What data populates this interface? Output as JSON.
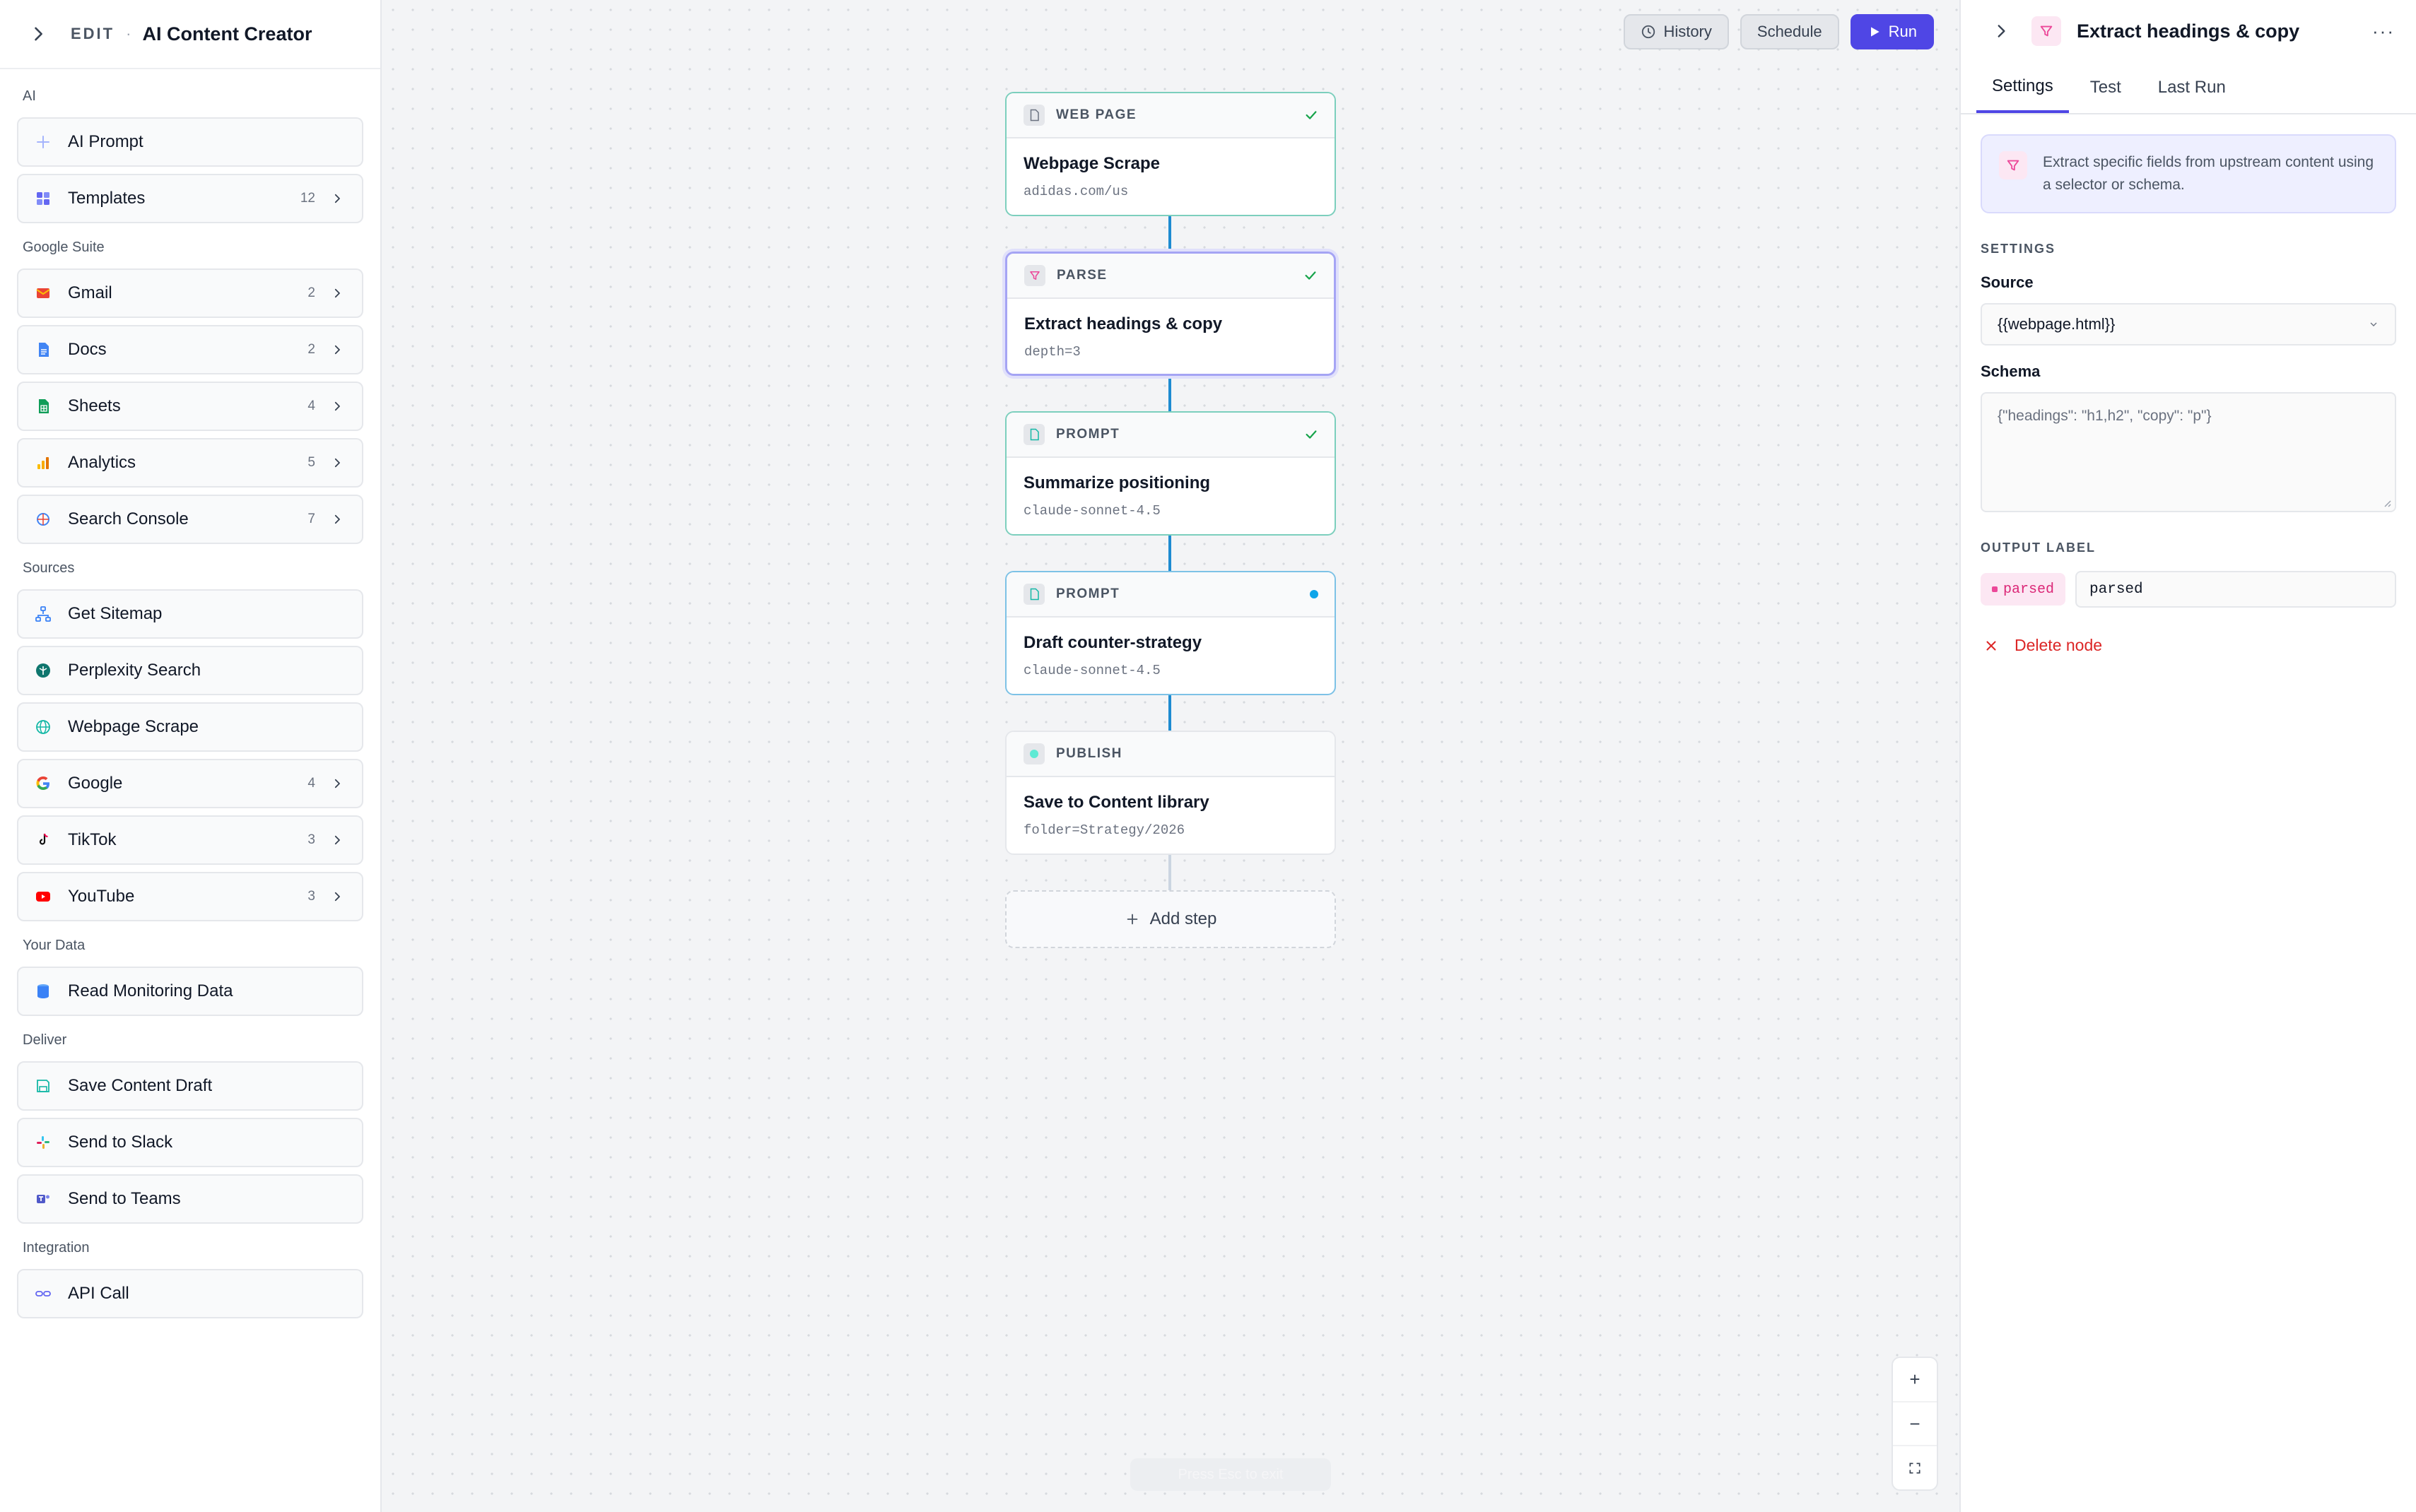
{
  "sidebar": {
    "edit_label": "EDIT",
    "separator": "·",
    "title": "AI Content Creator",
    "sections": [
      {
        "label": "AI",
        "items": [
          {
            "label": "AI Prompt",
            "icon": "sparkle-icon",
            "count": ""
          },
          {
            "label": "Templates",
            "icon": "grid-icon",
            "count": "12"
          }
        ]
      },
      {
        "label": "Google Suite",
        "items": [
          {
            "label": "Gmail",
            "icon": "gmail-icon",
            "count": "2"
          },
          {
            "label": "Docs",
            "icon": "docs-icon",
            "count": "2"
          },
          {
            "label": "Sheets",
            "icon": "sheets-icon",
            "count": "4"
          },
          {
            "label": "Analytics",
            "icon": "analytics-icon",
            "count": "5"
          },
          {
            "label": "Search Console",
            "icon": "search-console-icon",
            "count": "7"
          }
        ]
      },
      {
        "label": "Sources",
        "items": [
          {
            "label": "Get Sitemap",
            "icon": "sitemap-icon",
            "count": ""
          },
          {
            "label": "Perplexity Search",
            "icon": "perplexity-icon",
            "count": ""
          },
          {
            "label": "Webpage Scrape",
            "icon": "globe-icon",
            "count": ""
          },
          {
            "label": "Google",
            "icon": "google-icon",
            "count": "4"
          },
          {
            "label": "TikTok",
            "icon": "tiktok-icon",
            "count": "3"
          },
          {
            "label": "YouTube",
            "icon": "youtube-icon",
            "count": "3"
          }
        ]
      },
      {
        "label": "Your Data",
        "items": [
          {
            "label": "Read Monitoring Data",
            "icon": "database-icon",
            "count": ""
          }
        ]
      },
      {
        "label": "Deliver",
        "items": [
          {
            "label": "Save Content Draft",
            "icon": "save-icon",
            "count": ""
          },
          {
            "label": "Send to Slack",
            "icon": "slack-icon",
            "count": ""
          },
          {
            "label": "Send to Teams",
            "icon": "teams-icon",
            "count": ""
          }
        ]
      },
      {
        "label": "Integration",
        "items": [
          {
            "label": "API Call",
            "icon": "link-icon",
            "count": ""
          }
        ]
      }
    ]
  },
  "toolbar": {
    "history": "History",
    "schedule": "Schedule",
    "run": "Run"
  },
  "nodes": [
    {
      "type": "WEB PAGE",
      "title": "Webpage Scrape",
      "sub": "adidas.com/us",
      "status": "done"
    },
    {
      "type": "PARSE",
      "title": "Extract headings & copy",
      "sub": "depth=3",
      "status": "done"
    },
    {
      "type": "PROMPT",
      "title": "Summarize positioning",
      "sub": "claude-sonnet-4.5",
      "status": "done"
    },
    {
      "type": "PROMPT",
      "title": "Draft counter-strategy",
      "sub": "claude-sonnet-4.5",
      "status": "pending"
    },
    {
      "type": "PUBLISH",
      "title": "Save to Content library",
      "sub": "folder=Strategy/2026",
      "status": "idle"
    }
  ],
  "add_step": "Add step",
  "zoom": {
    "in": "+",
    "out": "−"
  },
  "esc_hint": "Press Esc to exit",
  "panel": {
    "title": "Extract headings & copy",
    "more": "···",
    "tabs": [
      "Settings",
      "Test",
      "Last Run"
    ],
    "info": "Extract specific fields from upstream content using a selector or schema.",
    "settings_label": "SETTINGS",
    "source_label": "Source",
    "source_value": "{{webpage.html}}",
    "schema_label": "Schema",
    "schema_placeholder": "{\"headings\": \"h1,h2\", \"copy\": \"p\"}",
    "output_label": "OUTPUT LABEL",
    "output_chip": "parsed",
    "output_value": "parsed",
    "delete": "Delete node"
  },
  "colors": {
    "accent": "#4f46e5",
    "success": "#16a34a",
    "pending": "#0ea5e9",
    "danger": "#dc2626",
    "connector": "#1d8bd1"
  }
}
